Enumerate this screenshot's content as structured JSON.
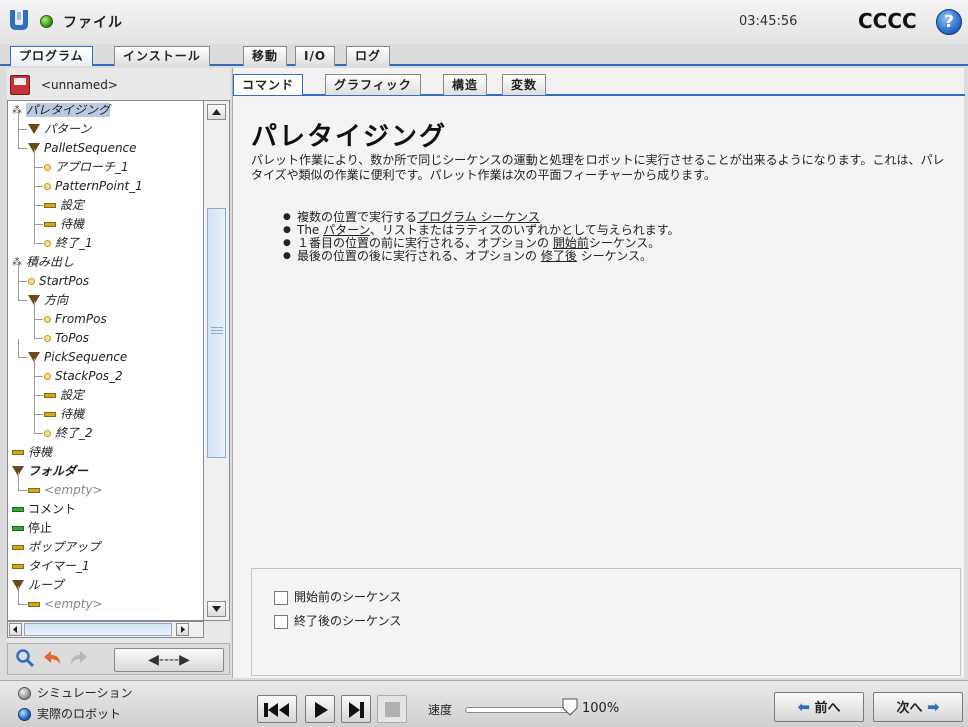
{
  "header": {
    "file_menu": "ファイル",
    "time": "03:45:56",
    "robot_name": "CCCC",
    "help_symbol": "?"
  },
  "main_tabs": [
    {
      "label": "プログラム",
      "active": true
    },
    {
      "label": "インストール",
      "active": false
    },
    {
      "label": "移動",
      "active": false
    },
    {
      "label": "I/O",
      "active": false
    },
    {
      "label": "ログ",
      "active": false
    }
  ],
  "program": {
    "name": "<unnamed>"
  },
  "tree": [
    {
      "label": "パレタイジング",
      "icon": "pallet-icon",
      "level": 0,
      "selected": true
    },
    {
      "label": "パターン",
      "icon": "triangle-icon",
      "level": 1
    },
    {
      "label": "PalletSequence",
      "icon": "triangle-icon",
      "level": 1
    },
    {
      "label": "アプローチ_1",
      "icon": "waypoint-icon",
      "level": 2
    },
    {
      "label": "PatternPoint_1",
      "icon": "waypoint-icon",
      "level": 2
    },
    {
      "label": "設定",
      "icon": "bar-icon",
      "level": 2
    },
    {
      "label": "待機",
      "icon": "bar-icon",
      "level": 2
    },
    {
      "label": "終了_1",
      "icon": "waypoint-icon",
      "level": 2
    },
    {
      "label": "積み出し",
      "icon": "pallet-icon",
      "level": 0
    },
    {
      "label": "StartPos",
      "icon": "waypoint-icon",
      "level": 1
    },
    {
      "label": "方向",
      "icon": "triangle-icon",
      "level": 1
    },
    {
      "label": "FromPos",
      "icon": "waypoint-icon",
      "level": 2
    },
    {
      "label": "ToPos",
      "icon": "waypoint-icon",
      "level": 2
    },
    {
      "label": "PickSequence",
      "icon": "triangle-icon",
      "level": 1
    },
    {
      "label": "StackPos_2",
      "icon": "waypoint-icon",
      "level": 2
    },
    {
      "label": "設定",
      "icon": "bar-icon",
      "level": 2
    },
    {
      "label": "待機",
      "icon": "bar-icon",
      "level": 2
    },
    {
      "label": "終了_2",
      "icon": "waypoint-icon",
      "level": 2
    },
    {
      "label": "待機",
      "icon": "bar-icon",
      "level": 0
    },
    {
      "label": "フォルダー",
      "icon": "triangle-icon",
      "level": 0,
      "bold": true
    },
    {
      "label": "<empty>",
      "icon": "bar-icon",
      "level": 1,
      "grey": true
    },
    {
      "label": "コメント",
      "icon": "green-bar-icon",
      "level": 0,
      "nonitalic": true
    },
    {
      "label": "停止",
      "icon": "green-bar-icon",
      "level": 0,
      "nonitalic": true
    },
    {
      "label": "ポップアップ",
      "icon": "bar-icon",
      "level": 0
    },
    {
      "label": "タイマー_1",
      "icon": "bar-icon",
      "level": 0
    },
    {
      "label": "ループ",
      "icon": "triangle-icon",
      "level": 0
    },
    {
      "label": "<empty>",
      "icon": "bar-icon",
      "level": 1,
      "grey": true
    }
  ],
  "sub_tabs": [
    {
      "label": "コマンド",
      "active": true
    },
    {
      "label": "グラフィック",
      "active": false
    },
    {
      "label": "構造",
      "active": false
    },
    {
      "label": "変数",
      "active": false
    }
  ],
  "command": {
    "title": "パレタイジング",
    "description": "パレット作業により、数か所で同じシーケンスの運動と処理をロボットに実行させることが出来るようになります。これは、パレタイズや類似の作業に便利です。パレット作業は次の平面フィーチャーから成ります。",
    "bullets": [
      {
        "pre": "複数の位置で実行する",
        "link": "プログラム シーケンス",
        "post": ""
      },
      {
        "pre": "The ",
        "link": "パターン",
        "post": "、リストまたはラティスのいずれかとして与えられます。"
      },
      {
        "pre": "１番目の位置の前に実行される、オプションの ",
        "link": "開始前",
        "post": "シーケンス。"
      },
      {
        "pre": "最後の位置の後に実行される、オプションの ",
        "link": "修了後",
        "post": " シーケンス。"
      }
    ],
    "option_before": "開始前のシーケンス",
    "option_after": "終了後のシーケンス"
  },
  "footer": {
    "simulation_label": "シミュレーション",
    "real_robot_label": "実際のロボット",
    "speed_label": "速度",
    "speed_value": "100%",
    "speed_fraction": 1.0,
    "prev_label": "前へ",
    "next_label": "次へ"
  },
  "toolbar": {
    "move_arrow": "◀----▶"
  }
}
